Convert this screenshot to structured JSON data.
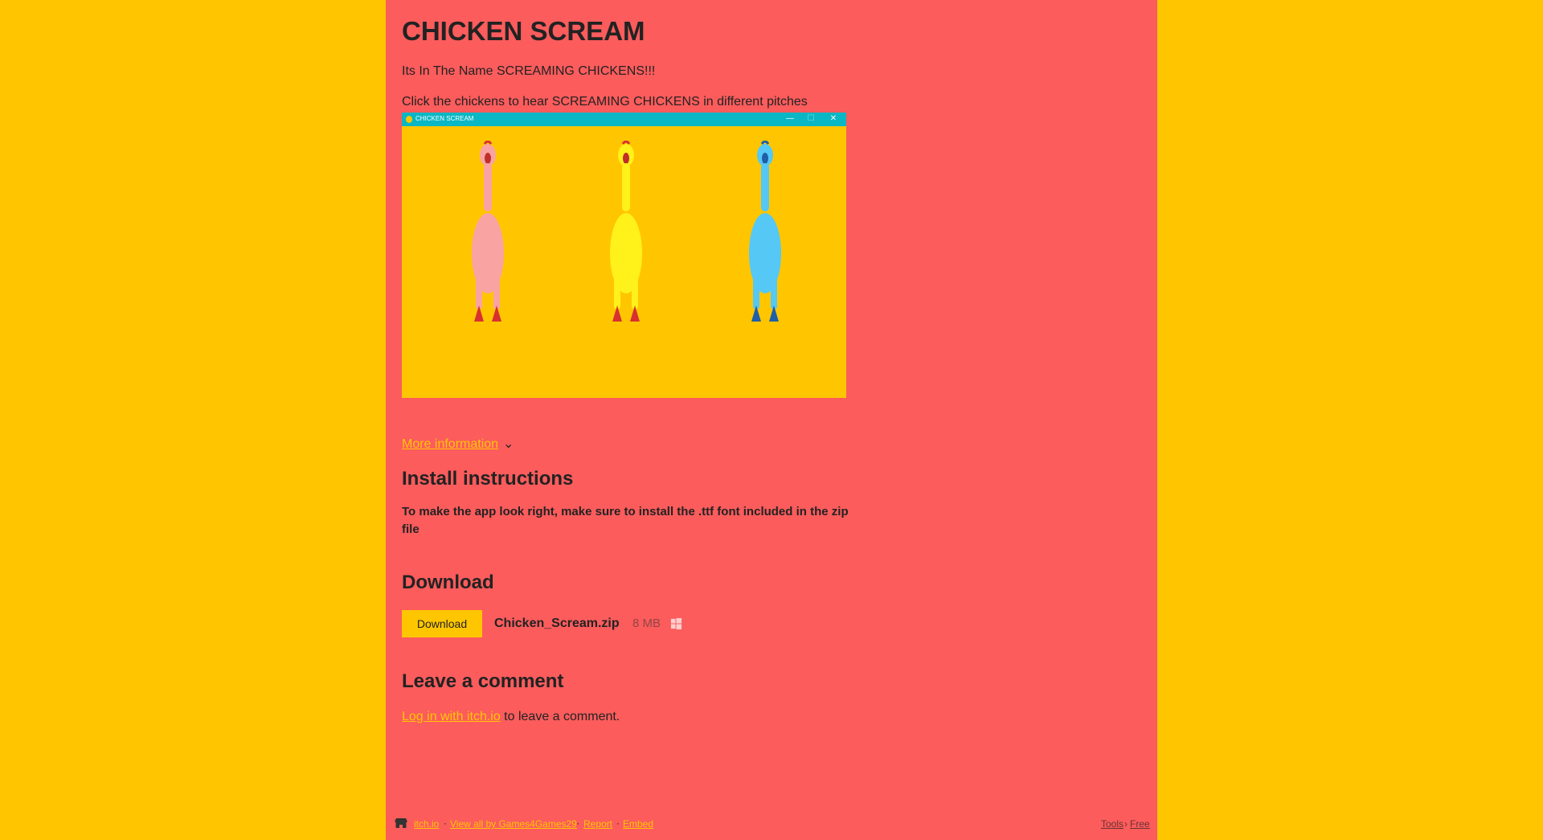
{
  "page": {
    "title": "CHICKEN SCREAM",
    "tagline": "Its In The Name SCREAMING CHICKENS!!!",
    "instruction": "Click the chickens to hear SCREAMING CHICKENS in different pitches"
  },
  "screenshot": {
    "window_title": "CHICKEN SCREAM",
    "minimize_glyph": "—",
    "maximize_glyph": "☐",
    "close_glyph": "✕",
    "chickens": [
      {
        "name": "pink-chicken",
        "body": "#f9a3a3",
        "feet": "#d83030"
      },
      {
        "name": "yellow-chicken",
        "body": "#fff11a",
        "feet": "#d83030"
      },
      {
        "name": "blue-chicken",
        "body": "#55c8f5",
        "feet": "#1f5fa8"
      }
    ]
  },
  "more_info": {
    "label": "More information",
    "chevron": "⌄"
  },
  "install": {
    "heading": "Install instructions",
    "text": " To make the app look right, make sure to install the .ttf font included in the zip file"
  },
  "download": {
    "heading": "Download",
    "button_label": "Download",
    "file_name": "Chicken_Scream.zip",
    "file_size": "8 MB",
    "platform_icon": "windows-icon"
  },
  "comment": {
    "heading": "Leave a comment",
    "login_link": "Log in with itch.io",
    "suffix": " to leave a comment."
  },
  "footer": {
    "itchio": "itch.io",
    "view_all": "View all by Games4Games29",
    "report": "Report",
    "embed": "Embed",
    "tools": "Tools",
    "separator": "›",
    "free": "Free",
    "dot": "·"
  },
  "colors": {
    "background": "#ffc600",
    "page": "#fc5c5c",
    "text": "#222222",
    "link": "#ffc600",
    "button": "#ffc600"
  }
}
